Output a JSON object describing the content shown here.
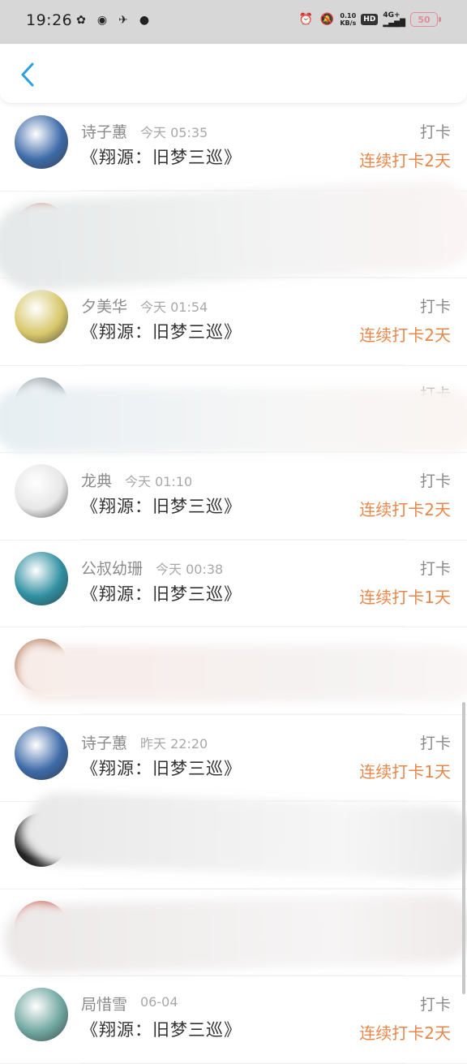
{
  "status_bar": {
    "time": "19:26",
    "net_speed_value": "0.10",
    "net_speed_unit": "KB/s",
    "hd": "HD",
    "signal": "4G+",
    "battery": "50"
  },
  "entries": [
    {
      "name": "诗子蕙",
      "time": "今天 05:35",
      "book": "《翔源：旧梦三巡》",
      "checkin": "打卡",
      "streak": "连续打卡2天",
      "avatar_color": "#3d6aa8"
    },
    {
      "name": "",
      "time": "",
      "book": "",
      "checkin": "",
      "streak": "",
      "avatar_color": "#c0392b",
      "obscured": true
    },
    {
      "name": "夕美华",
      "time": "今天 01:54",
      "book": "《翔源：旧梦三巡》",
      "checkin": "打卡",
      "streak": "连续打卡2天",
      "avatar_color": "#d8c76a"
    },
    {
      "name": "",
      "time": "",
      "book": "",
      "checkin": "打卡",
      "streak": "",
      "avatar_color": "#9aa5ad",
      "obscured": true
    },
    {
      "name": "龙典",
      "time": "今天 01:10",
      "book": "《翔源：旧梦三巡》",
      "checkin": "打卡",
      "streak": "连续打卡2天",
      "avatar_color": "#e7e7e7"
    },
    {
      "name": "公叔幼珊",
      "time": "今天 00:38",
      "book": "《翔源：旧梦三巡》",
      "checkin": "打卡",
      "streak": "连续打卡1天",
      "avatar_color": "#2f8fa0"
    },
    {
      "name": "",
      "time": "",
      "book": "",
      "checkin": "",
      "streak": "",
      "avatar_color": "#b47a5c",
      "obscured": true
    },
    {
      "name": "诗子蕙",
      "time": "昨天 22:20",
      "book": "《翔源：旧梦三巡》",
      "checkin": "打卡",
      "streak": "连续打卡1天",
      "avatar_color": "#3d6aa8"
    },
    {
      "name": "",
      "time": "",
      "book": "",
      "checkin": "",
      "streak": "",
      "avatar_color": "#1e1e1e",
      "obscured": true
    },
    {
      "name": "",
      "time": "",
      "book": "",
      "checkin": "",
      "streak": "",
      "avatar_color": "#c44a3a",
      "obscured": true
    },
    {
      "name": "局惜雪",
      "time": "06-04",
      "book": "《翔源：旧梦三巡》",
      "checkin": "打卡",
      "streak": "连续打卡2天",
      "avatar_color": "#6fa6a0"
    }
  ],
  "colors": {
    "accent_back": "#2aa0e0",
    "streak": "#e8874a",
    "name": "#8a8a8a"
  },
  "icons": {
    "back": "chevron-left-icon"
  }
}
